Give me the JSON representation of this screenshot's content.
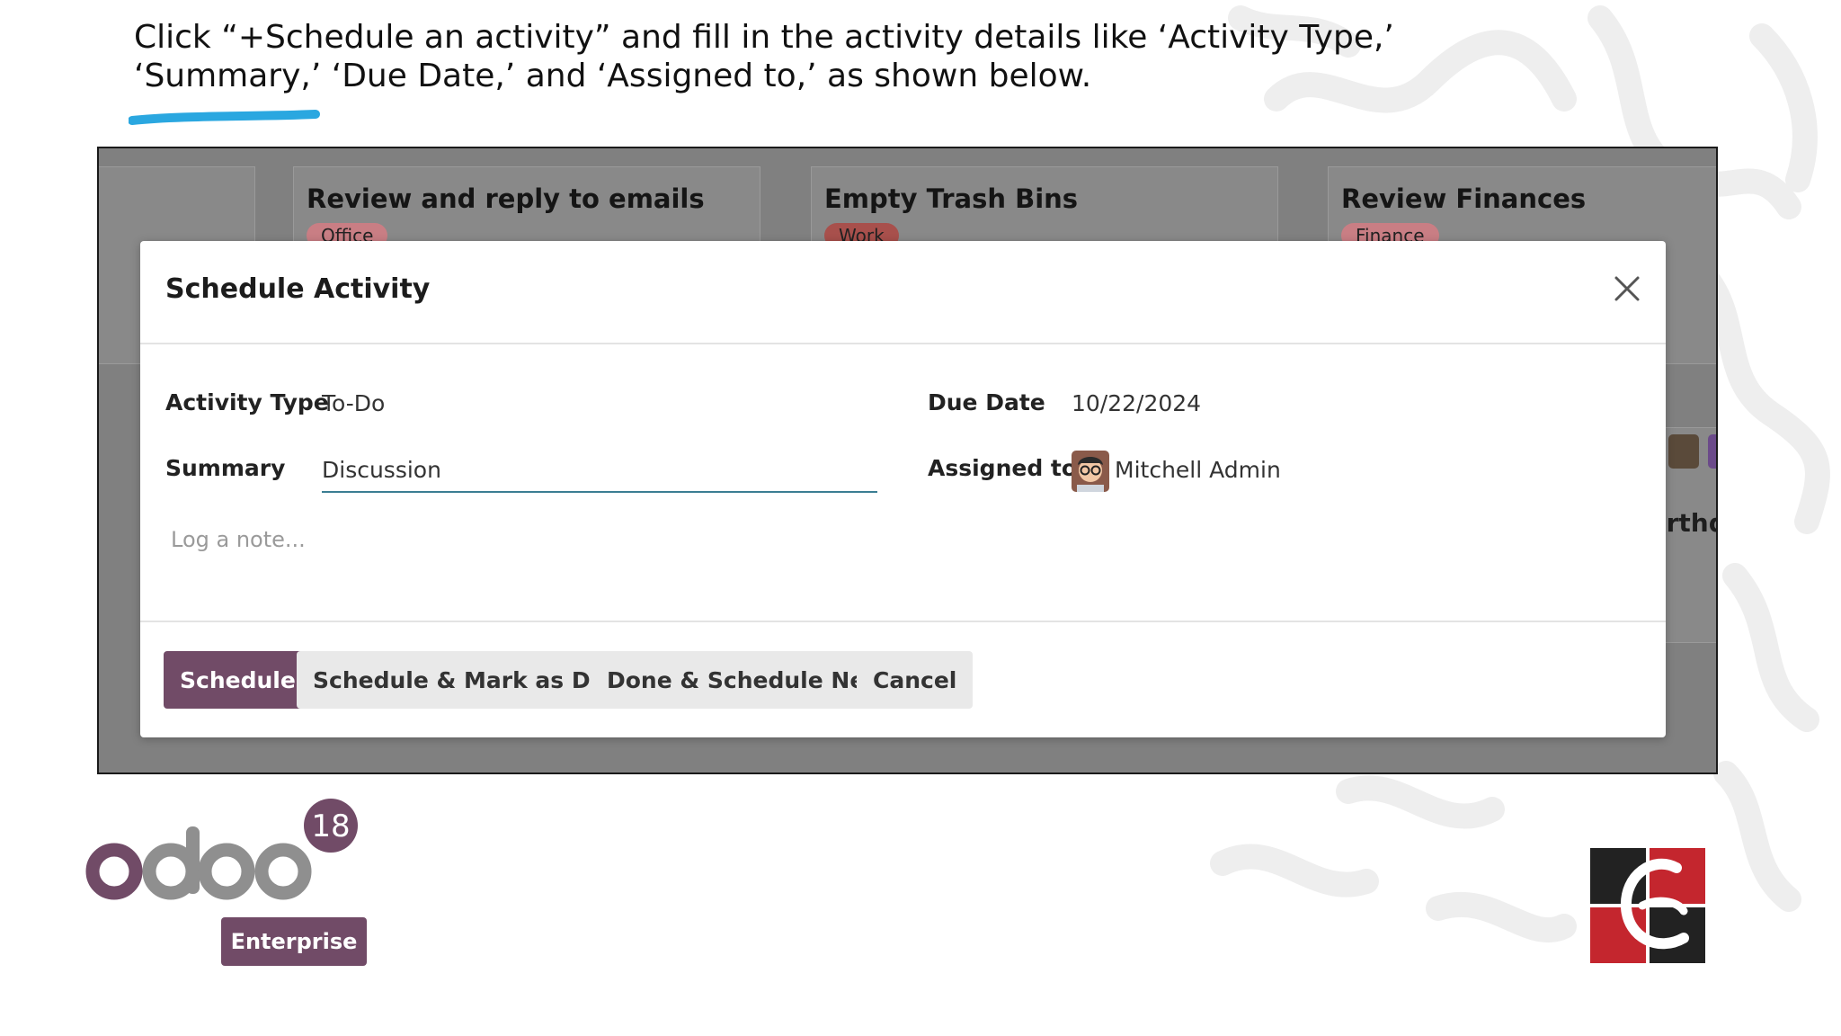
{
  "instruction": {
    "text": "Click “+Schedule an activity” and fill in the activity details like ‘Activity Type,’ ‘Summary,’ ‘Due Date,’ and ‘Assigned to,’ as shown below."
  },
  "background_cards": [
    {
      "title": "Review and reply to emails",
      "tag": "Office",
      "tag_color": "#e89aa0"
    },
    {
      "title": "Empty Trash Bins",
      "tag": "Work",
      "tag_color": "#d9564f"
    },
    {
      "title": "Review Finances",
      "tag": "Finance",
      "tag_color": "#e89aa0"
    }
  ],
  "background_fragment": "irthd",
  "modal": {
    "title": "Schedule Activity",
    "fields": {
      "activity_type_label": "Activity Type",
      "activity_type_value": "To-Do",
      "summary_label": "Summary",
      "summary_value": "Discussion",
      "due_date_label": "Due Date",
      "due_date_value": "10/22/2024",
      "assigned_to_label": "Assigned to",
      "assigned_to_value": "Mitchell Admin"
    },
    "note_placeholder": "Log a note...",
    "buttons": {
      "schedule": "Schedule",
      "schedule_mark_done": "Schedule & Mark as Done",
      "done_schedule_next": "Done & Schedule Next",
      "cancel": "Cancel"
    }
  },
  "branding": {
    "odoo_wordmark": "odoo",
    "odoo_version": "18",
    "edition": "Enterprise",
    "brand_color": "#714b67"
  }
}
